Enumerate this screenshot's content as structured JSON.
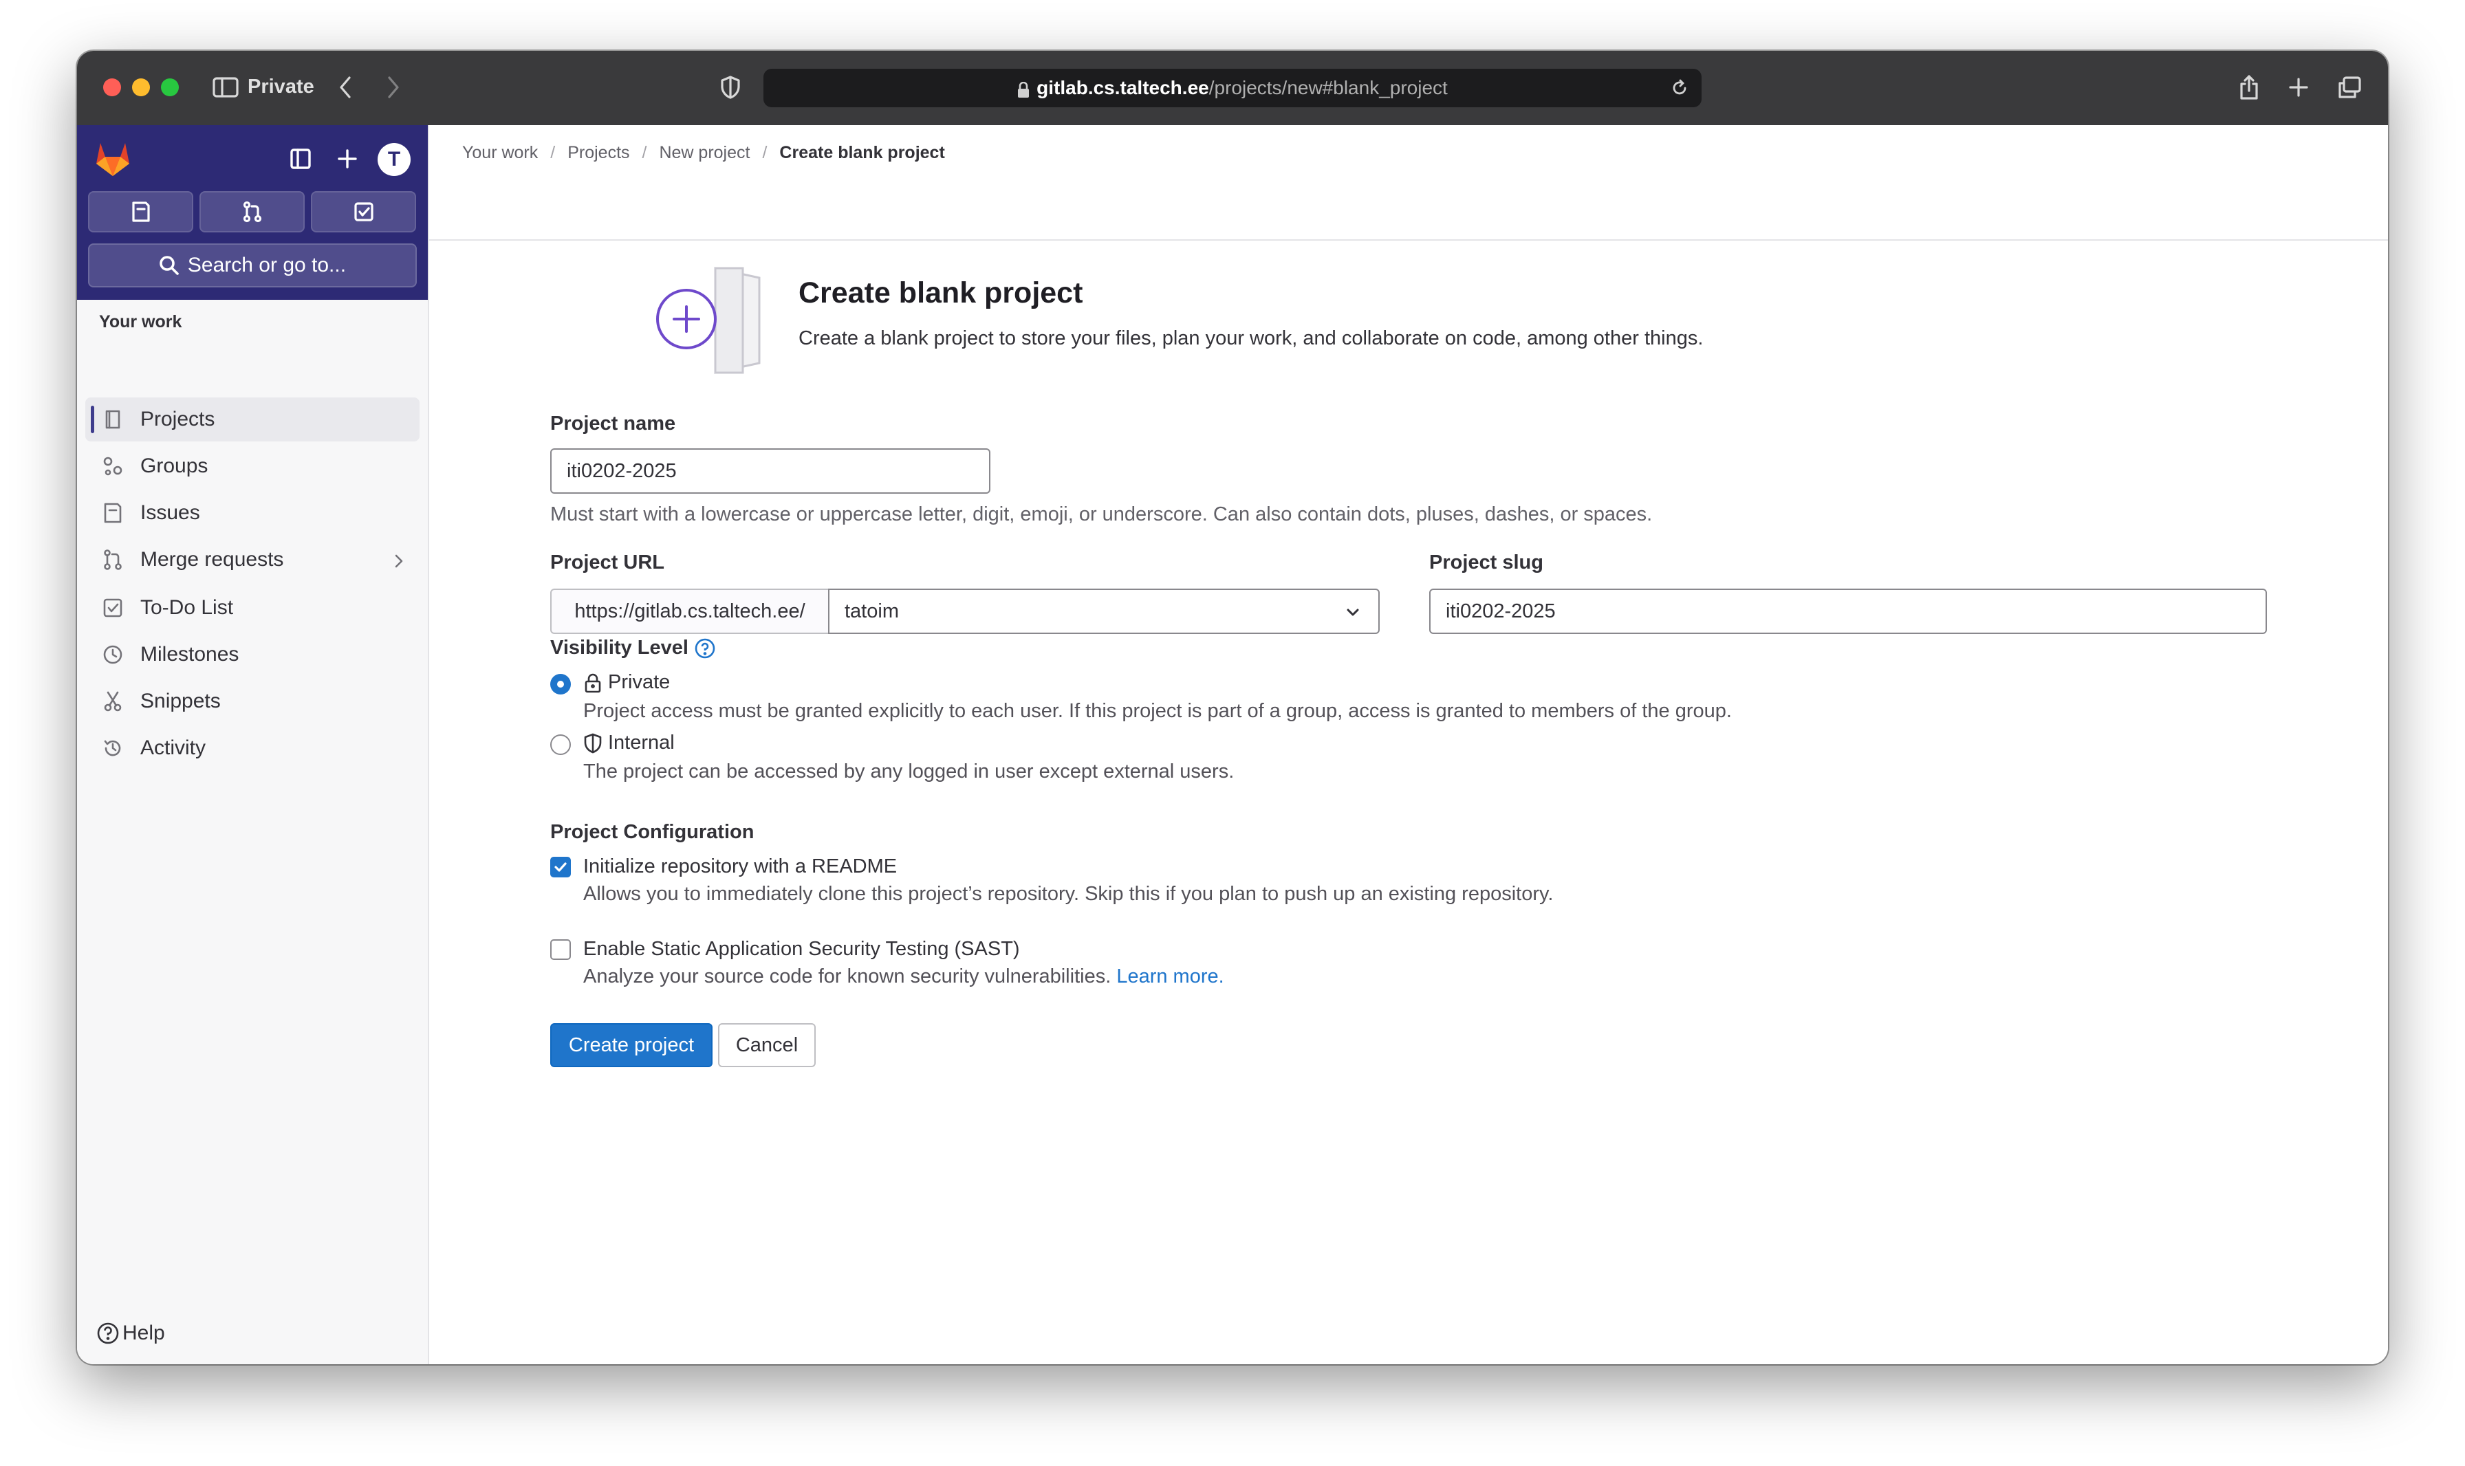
{
  "browser": {
    "private_label": "Private",
    "url_host": "gitlab.cs.taltech.ee",
    "url_path": "/projects/new#blank_project"
  },
  "sidebar": {
    "avatar_initial": "T",
    "search_label": "Search or go to...",
    "section_heading": "Your work",
    "items": [
      {
        "label": "Projects",
        "icon": "project-icon"
      },
      {
        "label": "Groups",
        "icon": "group-icon"
      },
      {
        "label": "Issues",
        "icon": "issues-icon"
      },
      {
        "label": "Merge requests",
        "icon": "merge-request-icon"
      },
      {
        "label": "To-Do List",
        "icon": "todo-icon"
      },
      {
        "label": "Milestones",
        "icon": "milestone-icon"
      },
      {
        "label": "Snippets",
        "icon": "snippet-icon"
      },
      {
        "label": "Activity",
        "icon": "history-icon"
      }
    ],
    "help_label": "Help"
  },
  "breadcrumb": [
    "Your work",
    "Projects",
    "New project",
    "Create blank project"
  ],
  "page": {
    "title": "Create blank project",
    "description": "Create a blank project to store your files, plan your work, and collaborate on code, among other things."
  },
  "form": {
    "project_name_label": "Project name",
    "project_name_value": "iti0202-2025",
    "project_name_help": "Must start with a lowercase or uppercase letter, digit, emoji, or underscore. Can also contain dots, pluses, dashes, or spaces.",
    "project_url_label": "Project URL",
    "url_prefix": "https://gitlab.cs.taltech.ee/",
    "namespace_value": "tatoim",
    "slash": "/",
    "project_slug_label": "Project slug",
    "project_slug_value": "iti0202-2025",
    "visibility_label": "Visibility Level",
    "visibility_options": [
      {
        "label": "Private",
        "description": "Project access must be granted explicitly to each user. If this project is part of a group, access is granted to members of the group.",
        "selected": true
      },
      {
        "label": "Internal",
        "description": "The project can be accessed by any logged in user except external users.",
        "selected": false
      }
    ],
    "config_label": "Project Configuration",
    "readme_label": "Initialize repository with a README",
    "readme_desc": "Allows you to immediately clone this project’s repository. Skip this if you plan to push up an existing repository.",
    "readme_checked": true,
    "sast_label": "Enable Static Application Security Testing (SAST)",
    "sast_desc": "Analyze your source code for known security vulnerabilities.",
    "sast_link": "Learn more.",
    "sast_checked": false,
    "create_button": "Create project",
    "cancel_button": "Cancel"
  },
  "colors": {
    "sidebar_header": "#2d2a75",
    "primary": "#1f75cb",
    "titlebar": "#3a3a3c"
  }
}
